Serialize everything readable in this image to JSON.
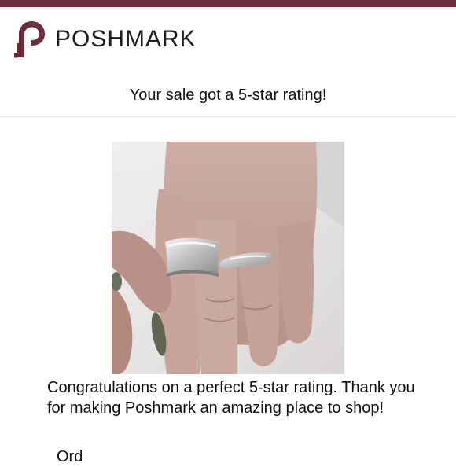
{
  "brand": {
    "name": "POSHMARK",
    "color": "#6b2d3b"
  },
  "email": {
    "subject_line": "Your sale got a 5-star rating!",
    "message": "Congratulations on a perfect 5-star rating. Thank you for making Poshmark an amazing place to shop!",
    "next_line_partial": "Ord"
  },
  "photo": {
    "subject": "hand wearing two silver rings"
  }
}
